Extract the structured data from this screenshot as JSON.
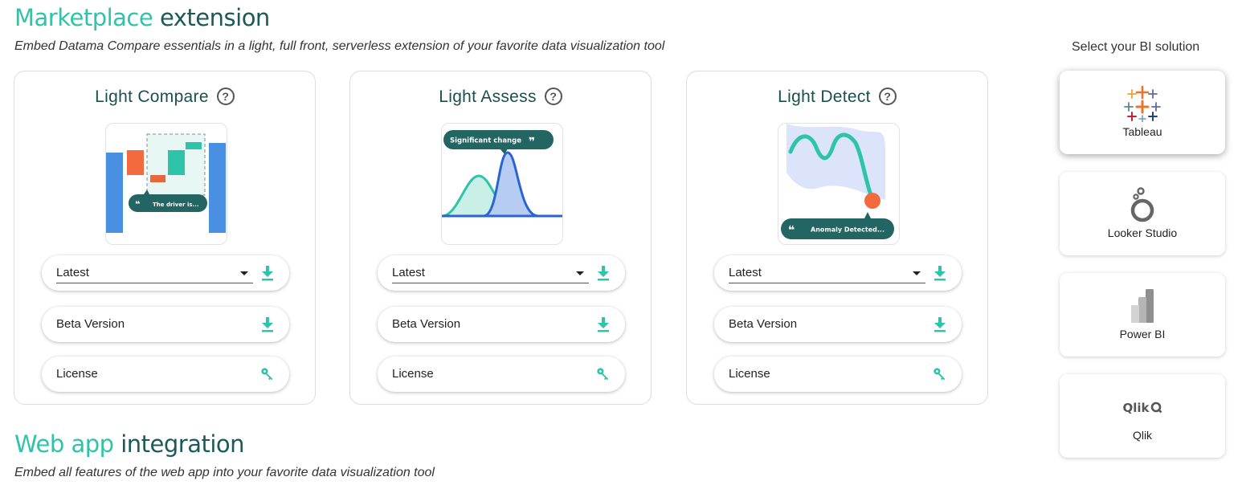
{
  "marketplace": {
    "title_part1": "Marketplace",
    "title_part2": "extension",
    "subtitle": "Embed Datama Compare essentials in a light, full front, serverless extension of your favorite data visualization tool"
  },
  "cards": [
    {
      "title": "Light Compare",
      "help": "?",
      "bubble_text": "The driver is...",
      "select_value": "Latest",
      "beta_label": "Beta Version",
      "license_label": "License"
    },
    {
      "title": "Light Assess",
      "help": "?",
      "bubble_text": "Significant change",
      "select_value": "Latest",
      "beta_label": "Beta Version",
      "license_label": "License"
    },
    {
      "title": "Light Detect",
      "help": "?",
      "bubble_text": "Anomaly Detected...",
      "select_value": "Latest",
      "beta_label": "Beta Version",
      "license_label": "License"
    }
  ],
  "bi": {
    "label": "Select your BI solution",
    "options": [
      {
        "name": "Tableau",
        "selected": true
      },
      {
        "name": "Looker Studio",
        "selected": false
      },
      {
        "name": "Power BI",
        "selected": false
      },
      {
        "name": "Qlik",
        "selected": false,
        "logo_text": "Qlik"
      }
    ]
  },
  "webapp": {
    "title_part1": "Web app",
    "title_part2": "integration",
    "subtitle": "Embed all features of the web app into your favorite data visualization tool"
  },
  "colors": {
    "accent": "#2ec4a9",
    "dark_teal": "#1c5a5a",
    "bubble": "#226563",
    "orange": "#f26a3d",
    "blue": "#4a90e2"
  },
  "icons": {
    "download": "download-icon",
    "key": "key-icon",
    "help": "help-circle-icon",
    "caret": "caret-down-icon"
  }
}
